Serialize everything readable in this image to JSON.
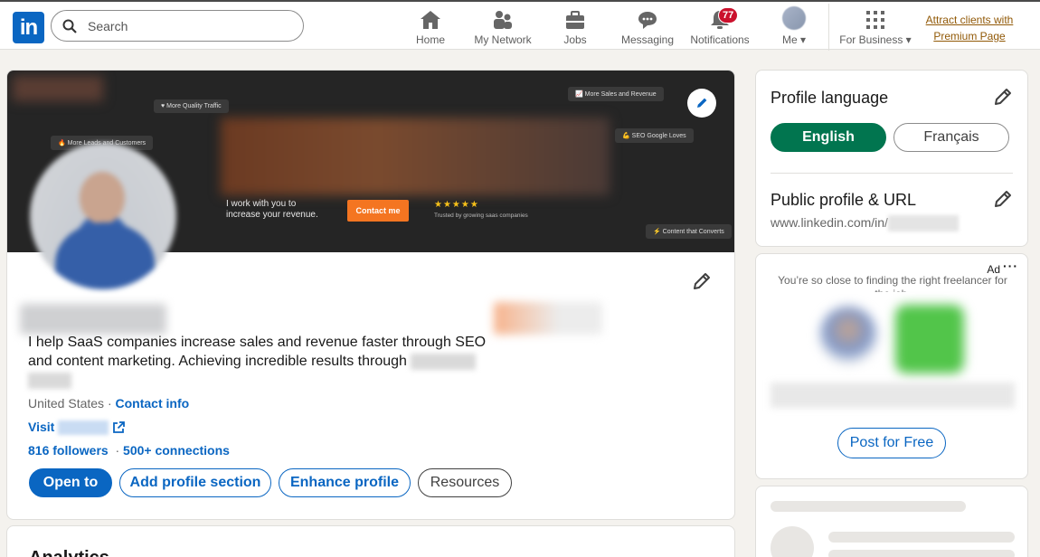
{
  "nav": {
    "logo": "in",
    "search_placeholder": "Search",
    "items": [
      {
        "label": "Home",
        "icon": "home-icon"
      },
      {
        "label": "My Network",
        "icon": "network-icon"
      },
      {
        "label": "Jobs",
        "icon": "briefcase-icon"
      },
      {
        "label": "Messaging",
        "icon": "messaging-icon"
      },
      {
        "label": "Notifications",
        "icon": "bell-icon",
        "badge": "77"
      },
      {
        "label": "Me",
        "icon": "avatar"
      },
      {
        "label": "For Business",
        "icon": "grid-icon"
      }
    ],
    "premium_line1": "Attract clients with",
    "premium_line2": "Premium Page"
  },
  "banner": {
    "chips": [
      "More Quality Traffic",
      "More Leads and Customers",
      "More Sales and Revenue",
      "SEO Google Loves",
      "Content that Converts"
    ],
    "tagline_line1": "I work with you to",
    "tagline_line2": "increase your revenue.",
    "cta": "Contact me",
    "stars": "★★★★★",
    "trusted": "Trusted by growing saas companies"
  },
  "profile": {
    "headline_line1": "I help SaaS companies increase sales and revenue faster through SEO",
    "headline_line2": "and content marketing. Achieving incredible results through",
    "location": "United States",
    "separator": "·",
    "contact_info": "Contact info",
    "visit_prefix": "Visit",
    "followers": "816 followers",
    "connections": "500+ connections",
    "buttons": {
      "open_to": "Open to",
      "add_section": "Add profile section",
      "enhance": "Enhance profile",
      "resources": "Resources"
    },
    "next_section_title": "Analytics"
  },
  "sidebar": {
    "profile_language_title": "Profile language",
    "lang_english": "English",
    "lang_french": "Français",
    "public_profile_title": "Public profile & URL",
    "public_url": "www.linkedin.com/in/",
    "ad_label": "Ad",
    "ad_text": "You’re so close to finding the right freelancer for the job.",
    "ad_cta": "Post for Free"
  },
  "colors": {
    "brand_blue": "#0a66c2",
    "english_green": "#01754f",
    "badge_red": "#cb112d",
    "premium_gold": "#915907"
  }
}
